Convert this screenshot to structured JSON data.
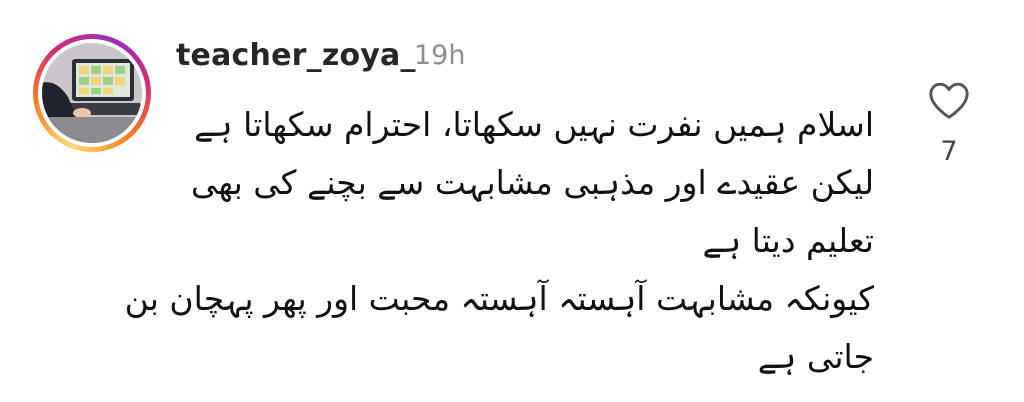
{
  "comment": {
    "username": "teacher_zoya_",
    "time": "19h",
    "lines": [
      "اسلام ہمیں نفرت نہیں سکھاتا، احترام سکھاتا ہے",
      "لیکن عقیدے اور مذہبی مشابہت سے بچنے کی بھی",
      "تعلیم دیتا ہے",
      "کیونکہ مشابہت آہستہ آہستہ محبت اور پھر پہچان بن",
      "جاتی ہے"
    ],
    "like_count": "7"
  },
  "icons": {
    "like": "heart-outline-icon",
    "avatar": "profile-photo"
  },
  "colors": {
    "ring_start": "#feda75",
    "ring_mid": "#d62976",
    "ring_end": "#962fbf",
    "username": "#262626",
    "timestamp": "#8e8e8e"
  }
}
